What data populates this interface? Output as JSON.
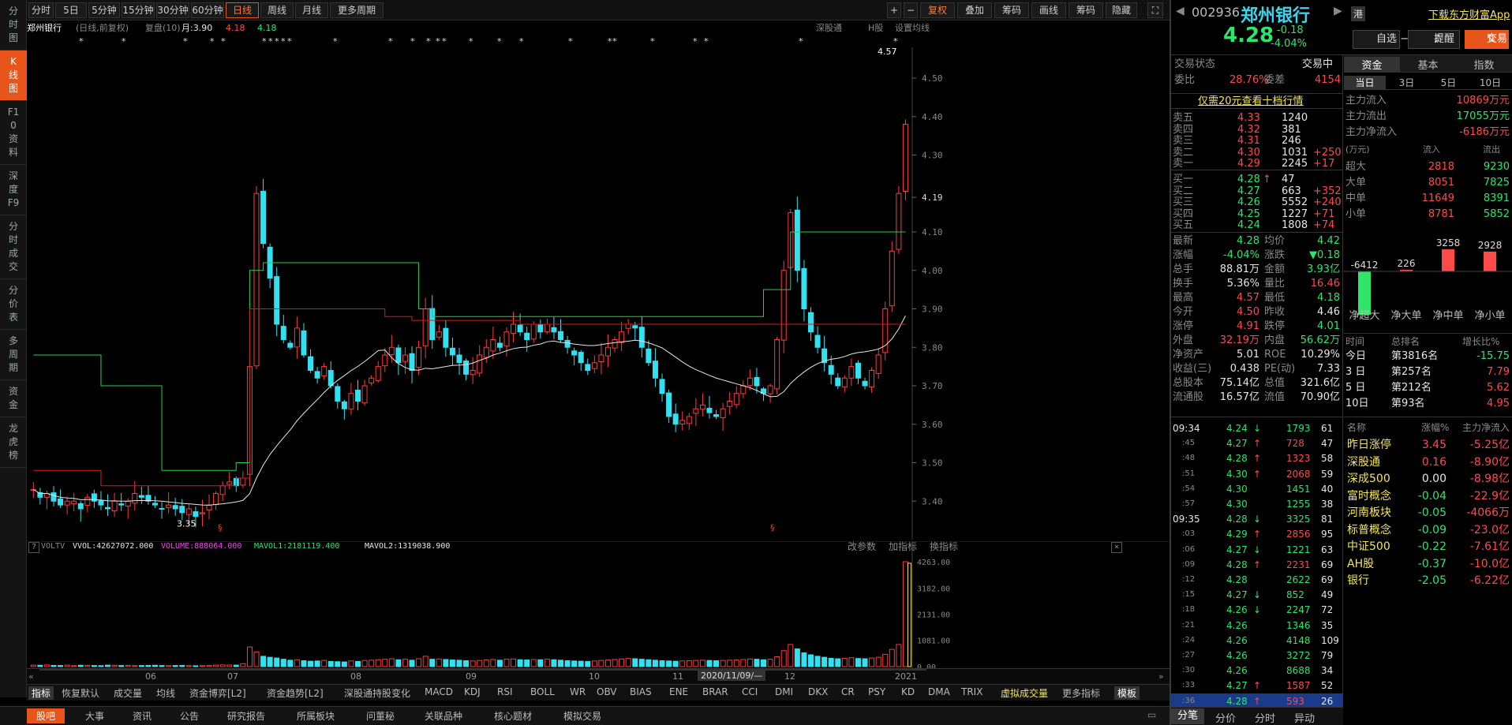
{
  "leftnav": [
    "分时图",
    "K线图",
    "F10资料",
    "深度F9",
    "分时成交",
    "分价表",
    "多周期",
    "资金",
    "龙虎榜"
  ],
  "toolbar": {
    "periods": [
      "分时",
      "5日",
      "5分钟",
      "15分钟",
      "30分钟",
      "60分钟",
      "日线",
      "周线",
      "月线",
      "更多周期"
    ],
    "right": [
      "+",
      "−",
      "复权",
      "叠加",
      "筹码",
      "画线",
      "筹码",
      "隐藏"
    ]
  },
  "chartinfo": {
    "name": "郑州银行",
    "mode": "(日线,前复权)",
    "fupan": "复盘(10)",
    "yue": "月:3.90",
    "v1": "4.18",
    "v2": "4.18",
    "right": [
      "深股通",
      "H股",
      "设置均线"
    ]
  },
  "kaxis": [
    "4.50",
    "4.40",
    "4.30",
    "4.19",
    "4.10",
    "4.00",
    "3.90",
    "3.80",
    "3.70",
    "3.60",
    "3.50",
    "3.40"
  ],
  "hi_label": "4.57",
  "lo_label": "3.35",
  "volinfo": {
    "name": "VOLTV",
    "vvol": "VVOL:42627072.000",
    "volume": "VOLUME:888064.000",
    "mavol1": "MAVOL1:2181119.400",
    "mavol2": "MAVOL2:1319038.900",
    "btns": [
      "改参数",
      "加指标",
      "换指标"
    ]
  },
  "volaxis": [
    "4263.00",
    "3182.00",
    "2131.00",
    "1081.00",
    "0.00"
  ],
  "xaxis": {
    "months": [
      "06",
      "07",
      "08",
      "09",
      "10",
      "11",
      "12",
      "2021"
    ],
    "cursor": "2020/11/09/—"
  },
  "indicators": [
    "指标",
    "恢复默认",
    "成交量",
    "均线",
    "资金博弈[L2]",
    "资金趋势[L2]",
    "深股通持股变化",
    "MACD",
    "KDJ",
    "RSI",
    "BOLL",
    "WR",
    "OBV",
    "BIAS",
    "ENE",
    "BRAR",
    "CCI",
    "DMI",
    "DKX",
    "CR",
    "PSY",
    "KD",
    "DMA",
    "TRIX",
    "虚拟成交量",
    "更多指标",
    "模板"
  ],
  "bottombar": [
    "股吧",
    "大事",
    "资讯",
    "公告",
    "研究报告",
    "所属板块",
    "问董秘",
    "关联品种",
    "核心题材",
    "模拟交易"
  ],
  "quote": {
    "code": "002936",
    "name": "郑州银行",
    "price": "4.28",
    "chg": "-0.18",
    "pct": "-4.04%",
    "hk": "港",
    "download": "下载东方财富App",
    "btn1": "自选 −",
    "btn2": "提醒",
    "btn3": "交易"
  },
  "orderbook": {
    "status_label": "交易状态",
    "status": "交易中",
    "weibi_label": "委比",
    "weibi": "28.76%",
    "weicha_label": "委差",
    "weicha": "4154",
    "ad": "仅需20元查看十档行情",
    "sells": [
      [
        "卖五",
        "4.33",
        "1240",
        ""
      ],
      [
        "卖四",
        "4.32",
        "381",
        ""
      ],
      [
        "卖三",
        "4.31",
        "246",
        ""
      ],
      [
        "卖二",
        "4.30",
        "1031",
        "+250"
      ],
      [
        "卖一",
        "4.29",
        "2245",
        "+17"
      ]
    ],
    "buys": [
      [
        "买一",
        "4.28",
        "47",
        ""
      ],
      [
        "买二",
        "4.27",
        "663",
        "+352"
      ],
      [
        "买三",
        "4.26",
        "5552",
        "+240"
      ],
      [
        "买四",
        "4.25",
        "1227",
        "+71"
      ],
      [
        "买五",
        "4.24",
        "1808",
        "+74"
      ]
    ],
    "stats": [
      [
        "最新",
        "4.28",
        "均价",
        "4.42"
      ],
      [
        "涨幅",
        "-4.04%",
        "涨跌",
        "▼0.18"
      ],
      [
        "总手",
        "88.81万",
        "金额",
        "3.93亿"
      ],
      [
        "换手",
        "5.36%",
        "量比",
        "16.46"
      ],
      [
        "最高",
        "4.57",
        "最低",
        "4.18"
      ],
      [
        "今开",
        "4.50",
        "昨收",
        "4.46"
      ],
      [
        "涨停",
        "4.91",
        "跌停",
        "4.01"
      ],
      [
        "外盘",
        "32.19万",
        "内盘",
        "56.62万"
      ],
      [
        "净资产",
        "5.01",
        "ROE",
        "10.29%"
      ],
      [
        "收益(三)",
        "0.438",
        "PE(动)",
        "7.33"
      ],
      [
        "总股本",
        "75.14亿",
        "总值",
        "321.6亿"
      ],
      [
        "流通股",
        "16.57亿",
        "流值",
        "70.90亿"
      ]
    ]
  },
  "ticks": [
    [
      "09:34",
      "4.24",
      "↓",
      "1793",
      "61"
    ],
    [
      ":45",
      "4.27",
      "↑",
      "728",
      "47"
    ],
    [
      ":48",
      "4.28",
      "↑",
      "1323",
      "58"
    ],
    [
      ":51",
      "4.30",
      "↑",
      "2068",
      "59"
    ],
    [
      ":54",
      "4.30",
      "",
      "1451",
      "40"
    ],
    [
      ":57",
      "4.30",
      "",
      "1255",
      "38"
    ],
    [
      "09:35",
      "4.28",
      "↓",
      "3325",
      "81"
    ],
    [
      ":03",
      "4.29",
      "↑",
      "2856",
      "95"
    ],
    [
      ":06",
      "4.27",
      "↓",
      "1221",
      "63"
    ],
    [
      ":09",
      "4.28",
      "↑",
      "2231",
      "69"
    ],
    [
      ":12",
      "4.28",
      "",
      "2622",
      "69"
    ],
    [
      ":15",
      "4.27",
      "↓",
      "852",
      "49"
    ],
    [
      ":18",
      "4.26",
      "↓",
      "2247",
      "72"
    ],
    [
      ":21",
      "4.26",
      "",
      "1346",
      "35"
    ],
    [
      ":24",
      "4.26",
      "",
      "4148",
      "109"
    ],
    [
      ":27",
      "4.26",
      "",
      "3272",
      "79"
    ],
    [
      ":30",
      "4.26",
      "",
      "8688",
      "34"
    ],
    [
      ":33",
      "4.27",
      "↑",
      "1587",
      "52"
    ],
    [
      ":36",
      "4.28",
      "↑",
      "593",
      "26"
    ]
  ],
  "rbot": [
    "分笔",
    "分价",
    "分时",
    "异动"
  ],
  "flowtabs": [
    "资金",
    "基本",
    "指数"
  ],
  "flowdays": [
    "当日",
    "3日",
    "5日",
    "10日"
  ],
  "flow_main": [
    [
      "主力流入",
      "10869万元"
    ],
    [
      "主力流出",
      "17055万元"
    ],
    [
      "主力净流入",
      "-6186万元"
    ]
  ],
  "flow_head": [
    "(万元)",
    "流入",
    "流出"
  ],
  "flow_rows": [
    [
      "超大",
      "2818",
      "9230"
    ],
    [
      "大单",
      "8051",
      "7825"
    ],
    [
      "中单",
      "11649",
      "8391"
    ],
    [
      "小单",
      "8781",
      "5852"
    ]
  ],
  "netflow": {
    "labels": [
      "净超大",
      "净大单",
      "净中单",
      "净小单"
    ],
    "values": [
      -6412,
      226,
      3258,
      2928
    ],
    "texts": [
      "-6412",
      "226",
      "3258",
      "2928"
    ]
  },
  "rank_head": [
    "时间",
    "总排名",
    "增长比%"
  ],
  "ranks": [
    [
      "今日",
      "第3816名",
      "-15.75"
    ],
    [
      "3 日",
      "第257名",
      "7.79"
    ],
    [
      "5 日",
      "第212名",
      "5.62"
    ],
    [
      "10日",
      "第93名",
      "4.95"
    ]
  ],
  "sector_head": [
    "名称",
    "涨幅%",
    "主力净流入"
  ],
  "sectors": [
    [
      "昨日涨停",
      "3.45",
      "-5.25亿"
    ],
    [
      "深股通",
      "0.16",
      "-8.90亿"
    ],
    [
      "深成500",
      "0.00",
      "-8.98亿"
    ],
    [
      "富时概念",
      "-0.04",
      "-22.9亿"
    ],
    [
      "河南板块",
      "-0.05",
      "-4066万"
    ],
    [
      "标普概念",
      "-0.09",
      "-23.0亿"
    ],
    [
      "中证500",
      "-0.22",
      "-7.61亿"
    ],
    [
      "AH股",
      "-0.37",
      "-10.0亿"
    ],
    [
      "银行",
      "-2.05",
      "-6.22亿"
    ]
  ],
  "chart_data": {
    "type": "candlestick",
    "ylim": [
      3.3,
      4.58
    ],
    "series_close": [
      3.43,
      3.41,
      3.42,
      3.4,
      3.39,
      3.4,
      3.4,
      3.38,
      3.41,
      3.4,
      3.39,
      3.38,
      3.4,
      3.39,
      3.4,
      3.42,
      3.41,
      3.4,
      3.39,
      3.38,
      3.39,
      3.38,
      3.37,
      3.38,
      3.36,
      3.37,
      3.39,
      3.42,
      3.44,
      3.45,
      3.44,
      3.46,
      3.75,
      4.2,
      4.07,
      3.98,
      3.86,
      3.82,
      3.8,
      3.85,
      3.78,
      3.74,
      3.72,
      3.75,
      3.7,
      3.66,
      3.64,
      3.68,
      3.66,
      3.7,
      3.72,
      3.75,
      3.78,
      3.8,
      3.76,
      3.78,
      3.74,
      3.8,
      3.9,
      3.82,
      3.84,
      3.8,
      3.78,
      3.76,
      3.73,
      3.74,
      3.78,
      3.8,
      3.82,
      3.8,
      3.84,
      3.86,
      3.84,
      3.82,
      3.86,
      3.84,
      3.86,
      3.84,
      3.82,
      3.8,
      3.78,
      3.76,
      3.74,
      3.76,
      3.78,
      3.8,
      3.82,
      3.84,
      3.86,
      3.85,
      3.8,
      3.76,
      3.72,
      3.68,
      3.62,
      3.6,
      3.61,
      3.62,
      3.64,
      3.65,
      3.63,
      3.62,
      3.64,
      3.66,
      3.68,
      3.7,
      3.72,
      3.7,
      3.68,
      3.7,
      3.82,
      4.0,
      4.15,
      4.0,
      3.9,
      3.84,
      3.8,
      3.76,
      3.73,
      3.7,
      3.72,
      3.75,
      3.72,
      3.7,
      3.74,
      3.78,
      3.9,
      4.05,
      4.2,
      4.38
    ]
  },
  "volume": {
    "values": [
      60,
      55,
      70,
      50,
      45,
      60,
      40,
      55,
      50,
      45,
      40,
      60,
      55,
      45,
      50,
      40,
      45,
      50,
      55,
      45,
      40,
      45,
      50,
      40,
      35,
      40,
      45,
      60,
      70,
      65,
      60,
      120,
      800,
      600,
      420,
      380,
      350,
      300,
      260,
      280,
      240,
      220,
      230,
      250,
      210,
      200,
      190,
      230,
      210,
      250,
      260,
      280,
      300,
      320,
      280,
      300,
      260,
      320,
      420,
      300,
      310,
      290,
      270,
      260,
      240,
      230,
      250,
      270,
      290,
      260,
      300,
      310,
      280,
      270,
      290,
      280,
      300,
      280,
      260,
      240,
      230,
      220,
      210,
      230,
      250,
      270,
      290,
      310,
      330,
      320,
      300,
      280,
      260,
      240,
      230,
      220,
      230,
      240,
      250,
      260,
      250,
      240,
      250,
      260,
      270,
      290,
      310,
      300,
      280,
      300,
      400,
      650,
      900,
      720,
      560,
      480,
      420,
      380,
      340,
      320,
      340,
      360,
      330,
      320,
      350,
      380,
      500,
      700,
      900,
      4263
    ]
  }
}
